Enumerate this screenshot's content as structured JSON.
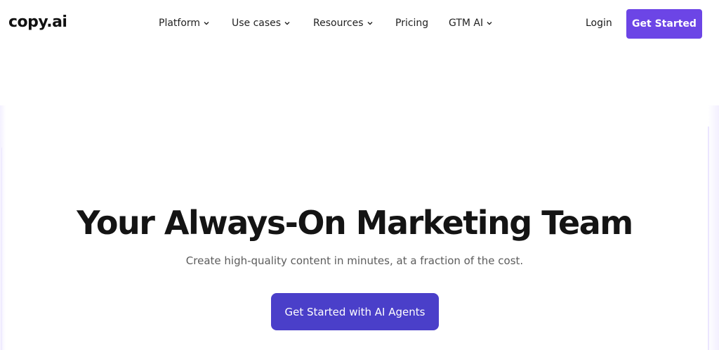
{
  "header": {
    "logo": "copy.ai",
    "nav": [
      {
        "label": "Platform",
        "has_dropdown": true
      },
      {
        "label": "Use cases",
        "has_dropdown": true
      },
      {
        "label": "Resources",
        "has_dropdown": true
      },
      {
        "label": "Pricing",
        "has_dropdown": false
      },
      {
        "label": "GTM AI",
        "has_dropdown": true
      }
    ],
    "login_label": "Login",
    "cta_label": "Get Started"
  },
  "hero": {
    "title": "Your Always-On Marketing Team",
    "subtitle": "Create high-quality content in minutes, at a fraction of the cost.",
    "cta_label": "Get Started with AI Agents"
  },
  "colors": {
    "brand_purple": "#6c45e6",
    "cta_indigo": "#4a3fc9"
  },
  "icons": {
    "dropdown": "chevron-down-icon"
  }
}
